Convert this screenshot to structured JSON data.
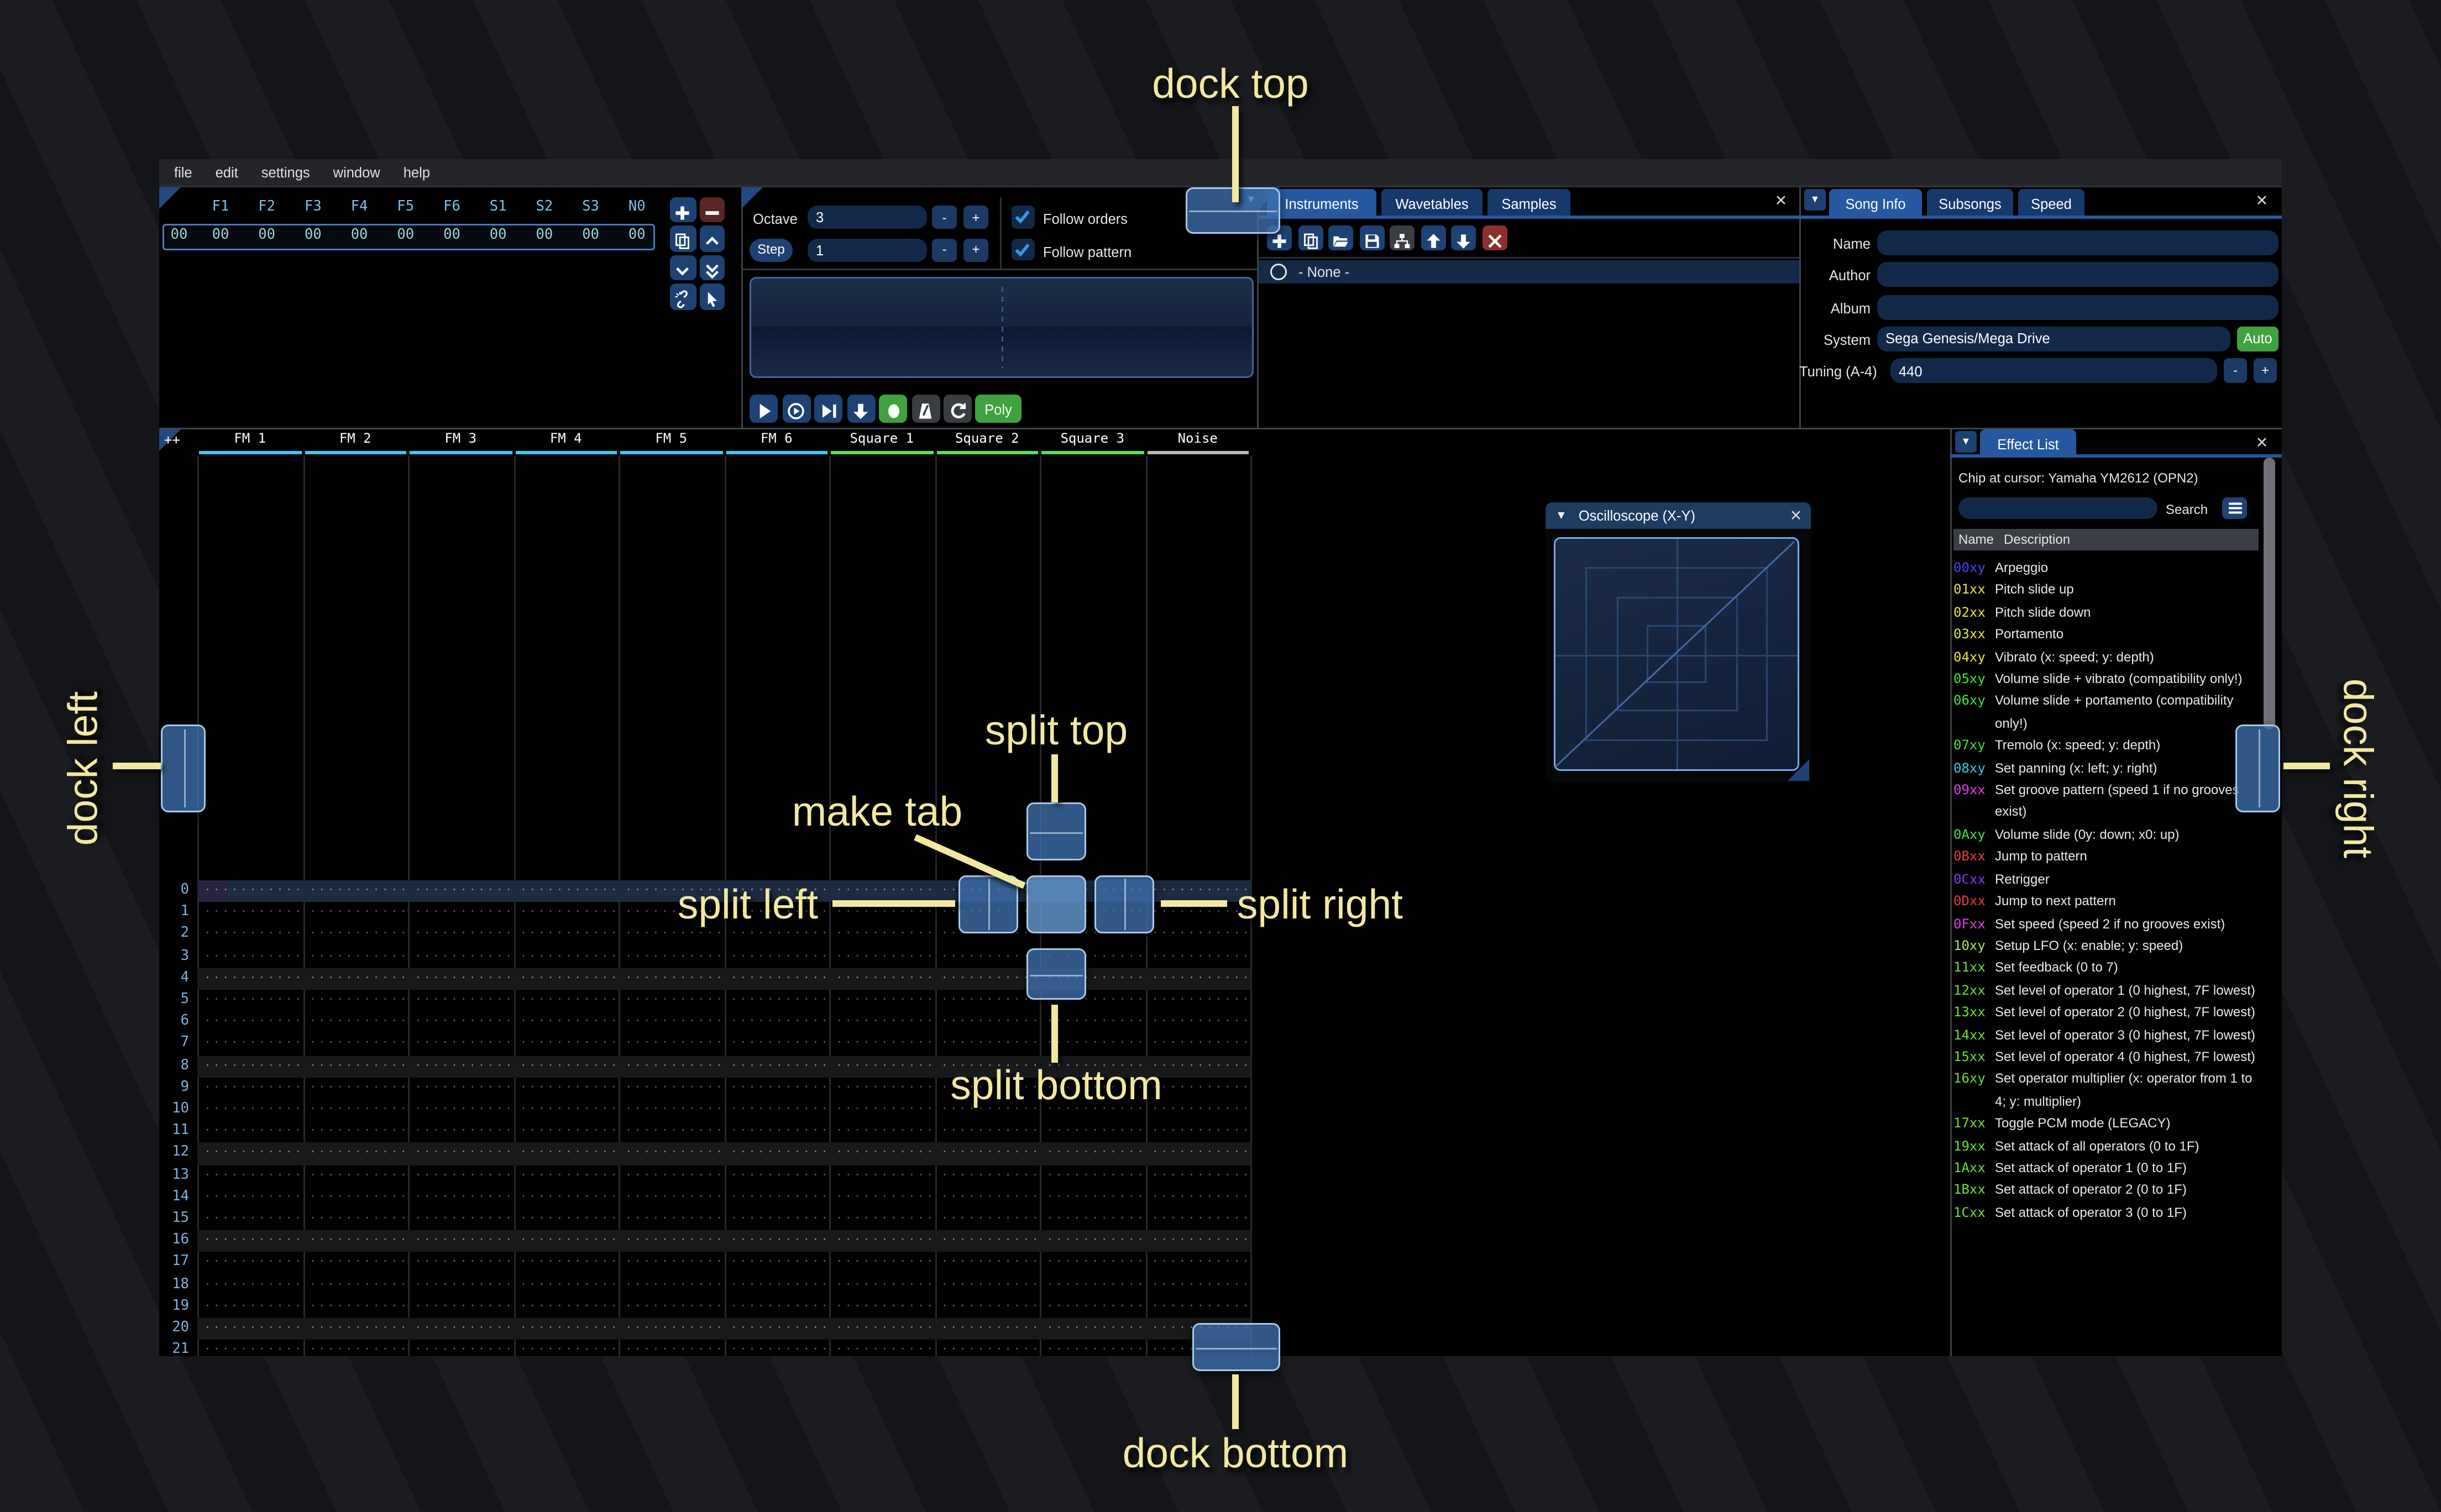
{
  "colors": {
    "accent": "#2558a0",
    "annotation": "#f2e8a0",
    "green": "#3fa23f",
    "delete_red": "#8c2f2f",
    "minus_red": "#5a2525",
    "input_bg": "#12294a",
    "fm_color": "#35cdf5",
    "square_color": "#55e055",
    "noise_color": "#b8b8b8",
    "row_highlight": "#1c2a42",
    "cursor_cell": "#2a2340"
  },
  "menu": {
    "items": [
      "file",
      "edit",
      "settings",
      "window",
      "help"
    ]
  },
  "orders": {
    "channels": [
      "F1",
      "F2",
      "F3",
      "F4",
      "F5",
      "F6",
      "S1",
      "S2",
      "S3",
      "N0"
    ],
    "row_index": "00",
    "row_values": [
      "00",
      "00",
      "00",
      "00",
      "00",
      "00",
      "00",
      "00",
      "00",
      "00"
    ],
    "buttons": [
      {
        "icon": "plus",
        "color": "#1d4273"
      },
      {
        "icon": "minus",
        "color": "#5a2525"
      },
      {
        "icon": "duplicate",
        "color": "#1d4273"
      },
      {
        "icon": "chevron-up",
        "color": "#1d4273"
      },
      {
        "icon": "chevron-down",
        "color": "#1d4273"
      },
      {
        "icon": "double-chevron-down",
        "color": "#1d4273"
      },
      {
        "icon": "unlink",
        "color": "#1d4273"
      },
      {
        "icon": "cursor",
        "color": "#1d4273"
      }
    ]
  },
  "controls": {
    "octave_label": "Octave",
    "octave_value": "3",
    "step_label": "Step",
    "step_value": "1",
    "minus": "-",
    "plus": "+",
    "follow_orders": "Follow orders",
    "follow_pattern": "Follow pattern",
    "transport": [
      {
        "icon": "play",
        "color": "#1d4273"
      },
      {
        "icon": "play-circle",
        "color": "#1d4273"
      },
      {
        "icon": "play-row",
        "color": "#1d4273"
      },
      {
        "icon": "arrow-down",
        "color": "#1d4273"
      },
      {
        "icon": "record",
        "color": "#3fa23f"
      },
      {
        "icon": "metronome",
        "color": "#3a3d42"
      },
      {
        "icon": "repeat",
        "color": "#3a3d42"
      }
    ],
    "poly_label": "Poly"
  },
  "instruments": {
    "tabs": [
      "Instruments",
      "Wavetables",
      "Samples"
    ],
    "toolbar": [
      {
        "icon": "plus",
        "color": "#1d4273"
      },
      {
        "icon": "duplicate",
        "color": "#1d4273"
      },
      {
        "icon": "folder-open",
        "color": "#1d4273"
      },
      {
        "icon": "save",
        "color": "#1d4273"
      },
      {
        "icon": "tree",
        "color": "#3a3d42"
      },
      {
        "icon": "arrow-up",
        "color": "#1d4273"
      },
      {
        "icon": "arrow-down",
        "color": "#1d4273"
      },
      {
        "icon": "x",
        "color": "#8c2f2f"
      }
    ],
    "none_item": "- None -"
  },
  "song_info": {
    "tabs": [
      "Song Info",
      "Subsongs",
      "Speed"
    ],
    "name_label": "Name",
    "author_label": "Author",
    "album_label": "Album",
    "system_label": "System",
    "system_value": "Sega Genesis/Mega Drive",
    "auto_label": "Auto",
    "tuning_label": "Tuning (A-4)",
    "tuning_value": "440",
    "minus": "-",
    "plus": "+"
  },
  "pattern": {
    "add_label": "++",
    "row_count": 22,
    "highlight_every": 4,
    "cursor_row": 0,
    "dots": "···········",
    "channels": [
      {
        "name": "FM 1",
        "color": "#35cdf5"
      },
      {
        "name": "FM 2",
        "color": "#35cdf5"
      },
      {
        "name": "FM 3",
        "color": "#35cdf5"
      },
      {
        "name": "FM 4",
        "color": "#35cdf5"
      },
      {
        "name": "FM 5",
        "color": "#35cdf5"
      },
      {
        "name": "FM 6",
        "color": "#35cdf5"
      },
      {
        "name": "Square 1",
        "color": "#55e055"
      },
      {
        "name": "Square 2",
        "color": "#55e055"
      },
      {
        "name": "Square 3",
        "color": "#55e055"
      },
      {
        "name": "Noise",
        "color": "#b8b8b8"
      }
    ]
  },
  "oscilloscope": {
    "title": "Oscilloscope (X-Y)"
  },
  "effect_list": {
    "tab": "Effect List",
    "chip_label": "Chip at cursor: Yamaha YM2612 (OPN2)",
    "search_label": "Search",
    "columns": {
      "name": "Name",
      "description": "Description"
    },
    "entries": [
      {
        "code": "00xy",
        "color": "#4343f2",
        "desc": "Arpeggio"
      },
      {
        "code": "01xx",
        "color": "#e6e63c",
        "desc": "Pitch slide up"
      },
      {
        "code": "02xx",
        "color": "#e6e63c",
        "desc": "Pitch slide down"
      },
      {
        "code": "03xx",
        "color": "#e6e63c",
        "desc": "Portamento"
      },
      {
        "code": "04xy",
        "color": "#e6e63c",
        "desc": "Vibrato (x: speed; y: depth)"
      },
      {
        "code": "05xy",
        "color": "#3ce63c",
        "desc": "Volume slide + vibrato (compatibility only!)"
      },
      {
        "code": "06xy",
        "color": "#3ce63c",
        "desc": "Volume slide + portamento (compatibility only!)"
      },
      {
        "code": "07xy",
        "color": "#3ce63c",
        "desc": "Tremolo (x: speed; y: depth)"
      },
      {
        "code": "08xy",
        "color": "#3cc8e6",
        "desc": "Set panning (x: left; y: right)"
      },
      {
        "code": "09xx",
        "color": "#e63ce6",
        "desc": "Set groove pattern (speed 1 if no grooves exist)"
      },
      {
        "code": "0Axy",
        "color": "#3ce63c",
        "desc": "Volume slide (0y: down; x0: up)"
      },
      {
        "code": "0Bxx",
        "color": "#e63c3c",
        "desc": "Jump to pattern"
      },
      {
        "code": "0Cxx",
        "color": "#7a3cf2",
        "desc": "Retrigger"
      },
      {
        "code": "0Dxx",
        "color": "#e63c3c",
        "desc": "Jump to next pattern"
      },
      {
        "code": "0Fxx",
        "color": "#e63ce6",
        "desc": "Set speed (speed 2 if no grooves exist)"
      },
      {
        "code": "10xy",
        "color": "#b4e63c",
        "desc": "Setup LFO (x: enable; y: speed)"
      },
      {
        "code": "11xx",
        "color": "#6fdd30",
        "desc": "Set feedback (0 to 7)"
      },
      {
        "code": "12xx",
        "color": "#6fdd30",
        "desc": "Set level of operator 1 (0 highest, 7F lowest)"
      },
      {
        "code": "13xx",
        "color": "#6fdd30",
        "desc": "Set level of operator 2 (0 highest, 7F lowest)"
      },
      {
        "code": "14xx",
        "color": "#6fdd30",
        "desc": "Set level of operator 3 (0 highest, 7F lowest)"
      },
      {
        "code": "15xx",
        "color": "#6fdd30",
        "desc": "Set level of operator 4 (0 highest, 7F lowest)"
      },
      {
        "code": "16xy",
        "color": "#6fdd30",
        "desc": "Set operator multiplier (x: operator from 1 to 4; y: multiplier)"
      },
      {
        "code": "17xx",
        "color": "#6fdd30",
        "desc": "Toggle PCM mode (LEGACY)"
      },
      {
        "code": "19xx",
        "color": "#6fdd30",
        "desc": "Set attack of all operators (0 to 1F)"
      },
      {
        "code": "1Axx",
        "color": "#6fdd30",
        "desc": "Set attack of operator 1 (0 to 1F)"
      },
      {
        "code": "1Bxx",
        "color": "#6fdd30",
        "desc": "Set attack of operator 2 (0 to 1F)"
      },
      {
        "code": "1Cxx",
        "color": "#6fdd30",
        "desc": "Set attack of operator 3 (0 to 1F)"
      }
    ]
  },
  "overlay": {
    "dock_top": "dock top",
    "dock_bottom": "dock bottom",
    "dock_left": "dock left",
    "dock_right": "dock right",
    "split_top": "split top",
    "split_bottom": "split bottom",
    "split_left": "split left",
    "split_right": "split right",
    "make_tab": "make tab"
  }
}
